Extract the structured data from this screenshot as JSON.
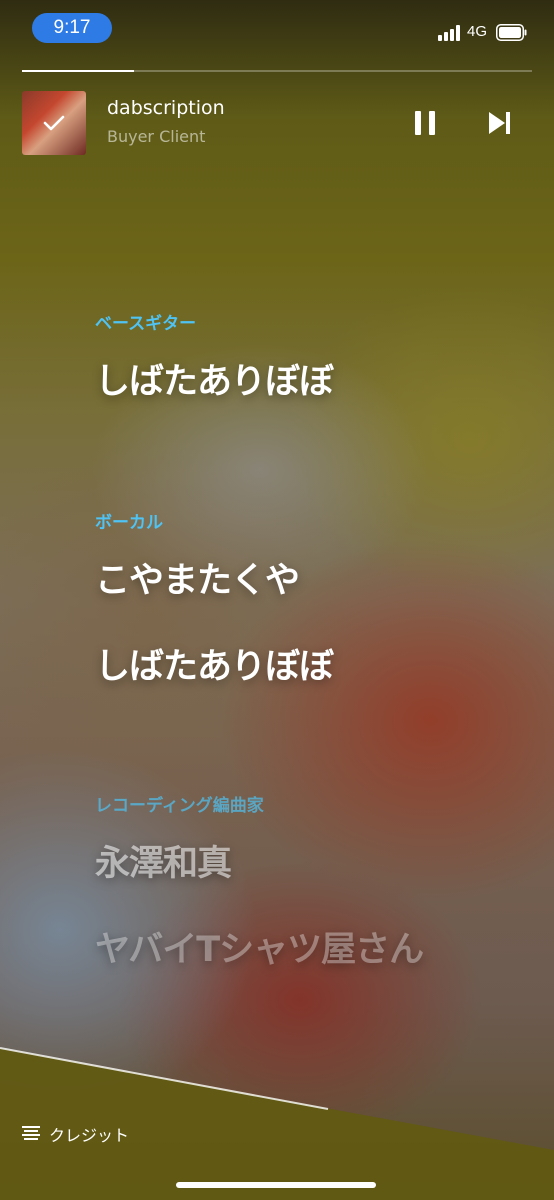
{
  "status_bar": {
    "time": "9:17",
    "network": "4G"
  },
  "player": {
    "progress_fraction": 0.22,
    "track_title": "dabscription",
    "track_artist": "Buyer Client"
  },
  "credits": [
    {
      "role": "ベースギター",
      "people": [
        "しばたありぼぼ"
      ]
    },
    {
      "role": "ボーカル",
      "people": [
        "こやまたくや",
        "しばたありぼぼ"
      ]
    },
    {
      "role": "レコーディング編曲家",
      "people": [
        "永澤和真",
        "ヤバイTシャツ屋さん"
      ]
    }
  ],
  "bottom_bar": {
    "credits_label": "クレジット"
  },
  "colors": {
    "accent_blue": "#4fc3f3",
    "time_pill": "#2f7be6"
  },
  "icons": {
    "album_check": "checkmark-icon",
    "pause": "pause-icon",
    "next": "skip-next-icon",
    "credits": "lines-list-icon"
  }
}
